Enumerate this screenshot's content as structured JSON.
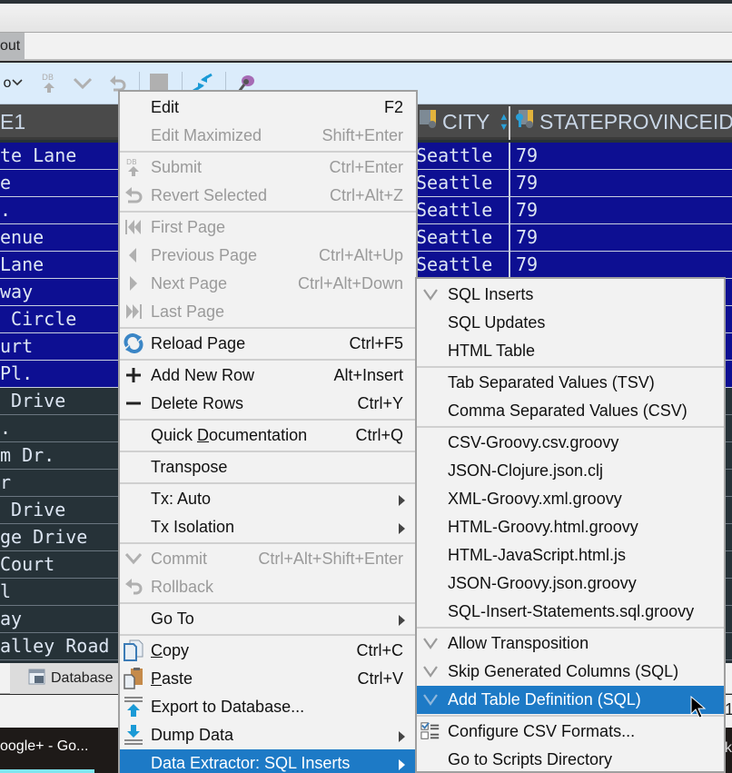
{
  "tab_bar": {
    "partial_tab_label": "out"
  },
  "toolbar": {
    "partial_label": "o",
    "items": [
      "dropdown-chevron",
      "submit-db",
      "commit-check",
      "revert",
      "stop",
      "compare",
      "pin"
    ]
  },
  "grid": {
    "headers": [
      {
        "label": "E1"
      },
      {
        "label": "CITY",
        "icon": "column-icon",
        "sort": "sort-icon"
      },
      {
        "label": "STATEPROVINCEID",
        "icon": "key-column-icon"
      }
    ],
    "rows": [
      {
        "address": "te Lane",
        "city": "Seattle",
        "state": "79",
        "selected": true
      },
      {
        "address": "e",
        "city": "Seattle",
        "state": "79",
        "selected": true
      },
      {
        "address": ".",
        "city": "Seattle",
        "state": "79",
        "selected": true
      },
      {
        "address": "enue",
        "city": "Seattle",
        "state": "79",
        "selected": true
      },
      {
        "address": "Lane",
        "city": "Seattle",
        "state": "79",
        "selected": true
      },
      {
        "address": "way",
        "city": "",
        "state": "",
        "selected": true
      },
      {
        "address": " Circle",
        "city": "",
        "state": "",
        "selected": true
      },
      {
        "address": "urt",
        "city": "",
        "state": "",
        "selected": true
      },
      {
        "address": "Pl.",
        "city": "",
        "state": "",
        "selected": true
      },
      {
        "address": " Drive",
        "city": "",
        "state": "",
        "selected": false
      },
      {
        "address": ".",
        "city": "",
        "state": "",
        "selected": false
      },
      {
        "address": "m Dr.",
        "city": "",
        "state": "",
        "selected": false
      },
      {
        "address": "r",
        "city": "",
        "state": "",
        "selected": false
      },
      {
        "address": " Drive",
        "city": "",
        "state": "",
        "selected": false
      },
      {
        "address": "ge Drive",
        "city": "",
        "state": "",
        "selected": false
      },
      {
        "address": "Court",
        "city": "",
        "state": "",
        "selected": false
      },
      {
        "address": "l",
        "city": "",
        "state": "",
        "selected": false
      },
      {
        "address": "ay",
        "city": "",
        "state": "",
        "selected": false
      },
      {
        "address": "alley Road",
        "city": "",
        "state": "",
        "selected": false
      }
    ]
  },
  "bottom_panel": {
    "database_tab_label": "Database"
  },
  "taskbar": {
    "item_label": "oogle+ - Go..."
  },
  "status_partial": {
    "right_digit": "1",
    "right_letter": "k"
  },
  "context_menu": {
    "items": [
      {
        "label": "Edit",
        "shortcut": "F2",
        "disabled": false
      },
      {
        "label": "Edit Maximized",
        "shortcut": "Shift+Enter",
        "disabled": true
      },
      {
        "label": "Submit",
        "shortcut": "Ctrl+Enter",
        "disabled": true,
        "icon": "db-submit-icon"
      },
      {
        "label": "Revert Selected",
        "shortcut": "Ctrl+Alt+Z",
        "disabled": true,
        "icon": "revert-icon"
      },
      {
        "label": "First Page",
        "shortcut": "",
        "disabled": true,
        "icon": "first-page-icon"
      },
      {
        "label": "Previous Page",
        "shortcut": "Ctrl+Alt+Up",
        "disabled": true,
        "icon": "previous-page-icon"
      },
      {
        "label": "Next Page",
        "shortcut": "Ctrl+Alt+Down",
        "disabled": true,
        "icon": "next-page-icon"
      },
      {
        "label": "Last Page",
        "shortcut": "",
        "disabled": true,
        "icon": "last-page-icon"
      },
      {
        "label": "Reload Page",
        "shortcut": "Ctrl+F5",
        "disabled": false,
        "icon": "reload-icon"
      },
      {
        "label": "Add New Row",
        "shortcut": "Alt+Insert",
        "disabled": false,
        "icon": "plus-icon"
      },
      {
        "label": "Delete Rows",
        "shortcut": "Ctrl+Y",
        "disabled": false,
        "icon": "minus-icon"
      },
      {
        "label_pre": "Quick ",
        "label_u": "D",
        "label_post": "ocumentation",
        "shortcut": "Ctrl+Q",
        "disabled": false
      },
      {
        "label": "Transpose",
        "shortcut": "",
        "disabled": false
      },
      {
        "label": "Tx: Auto",
        "submenu": true,
        "disabled": false
      },
      {
        "label": "Tx Isolation",
        "submenu": true,
        "disabled": false
      },
      {
        "label": "Commit",
        "shortcut": "Ctrl+Alt+Shift+Enter",
        "disabled": true,
        "icon": "commit-check-icon"
      },
      {
        "label": "Rollback",
        "shortcut": "",
        "disabled": true,
        "icon": "rollback-icon"
      },
      {
        "label": "Go To",
        "submenu": true,
        "disabled": false
      },
      {
        "label_u": "C",
        "label_post": "opy",
        "shortcut": "Ctrl+C",
        "disabled": false,
        "icon": "copy-icon"
      },
      {
        "label_u": "P",
        "label_post": "aste",
        "shortcut": "Ctrl+V",
        "disabled": false,
        "icon": "paste-icon"
      },
      {
        "label": "Export to Database...",
        "disabled": false,
        "icon": "export-icon"
      },
      {
        "label": "Dump Data",
        "submenu": true,
        "disabled": false,
        "icon": "dump-icon"
      },
      {
        "label": "Data Extractor: SQL Inserts",
        "submenu": true,
        "disabled": false,
        "highlighted": true
      }
    ]
  },
  "submenu": {
    "items": [
      {
        "label": "SQL Inserts",
        "checked": true
      },
      {
        "label": "SQL Updates",
        "checked": false
      },
      {
        "label": "HTML Table",
        "checked": false
      },
      {
        "label": "Tab Separated Values (TSV)",
        "checked": false
      },
      {
        "label": "Comma Separated Values (CSV)",
        "checked": false
      },
      {
        "label": "CSV-Groovy.csv.groovy",
        "checked": false
      },
      {
        "label": "JSON-Clojure.json.clj",
        "checked": false
      },
      {
        "label": "XML-Groovy.xml.groovy",
        "checked": false
      },
      {
        "label": "HTML-Groovy.html.groovy",
        "checked": false
      },
      {
        "label": "HTML-JavaScript.html.js",
        "checked": false
      },
      {
        "label": "JSON-Groovy.json.groovy",
        "checked": false
      },
      {
        "label": "SQL-Insert-Statements.sql.groovy",
        "checked": false
      },
      {
        "label": "Allow Transposition",
        "checked": true
      },
      {
        "label": "Skip Generated Columns (SQL)",
        "checked": true
      },
      {
        "label": "Add Table Definition (SQL)",
        "checked": true,
        "highlighted": true
      },
      {
        "label": "Configure CSV Formats...",
        "checked": false,
        "icon": "configure-csv-icon"
      },
      {
        "label": "Go to Scripts Directory",
        "checked": false
      }
    ]
  },
  "colors": {
    "selection_row": "#0d0f92",
    "grid_bg": "#263238",
    "menu_bg": "#f2f2f2",
    "menu_highlight": "#1d7ac6",
    "toolbar_bg": "#dbecfb"
  }
}
